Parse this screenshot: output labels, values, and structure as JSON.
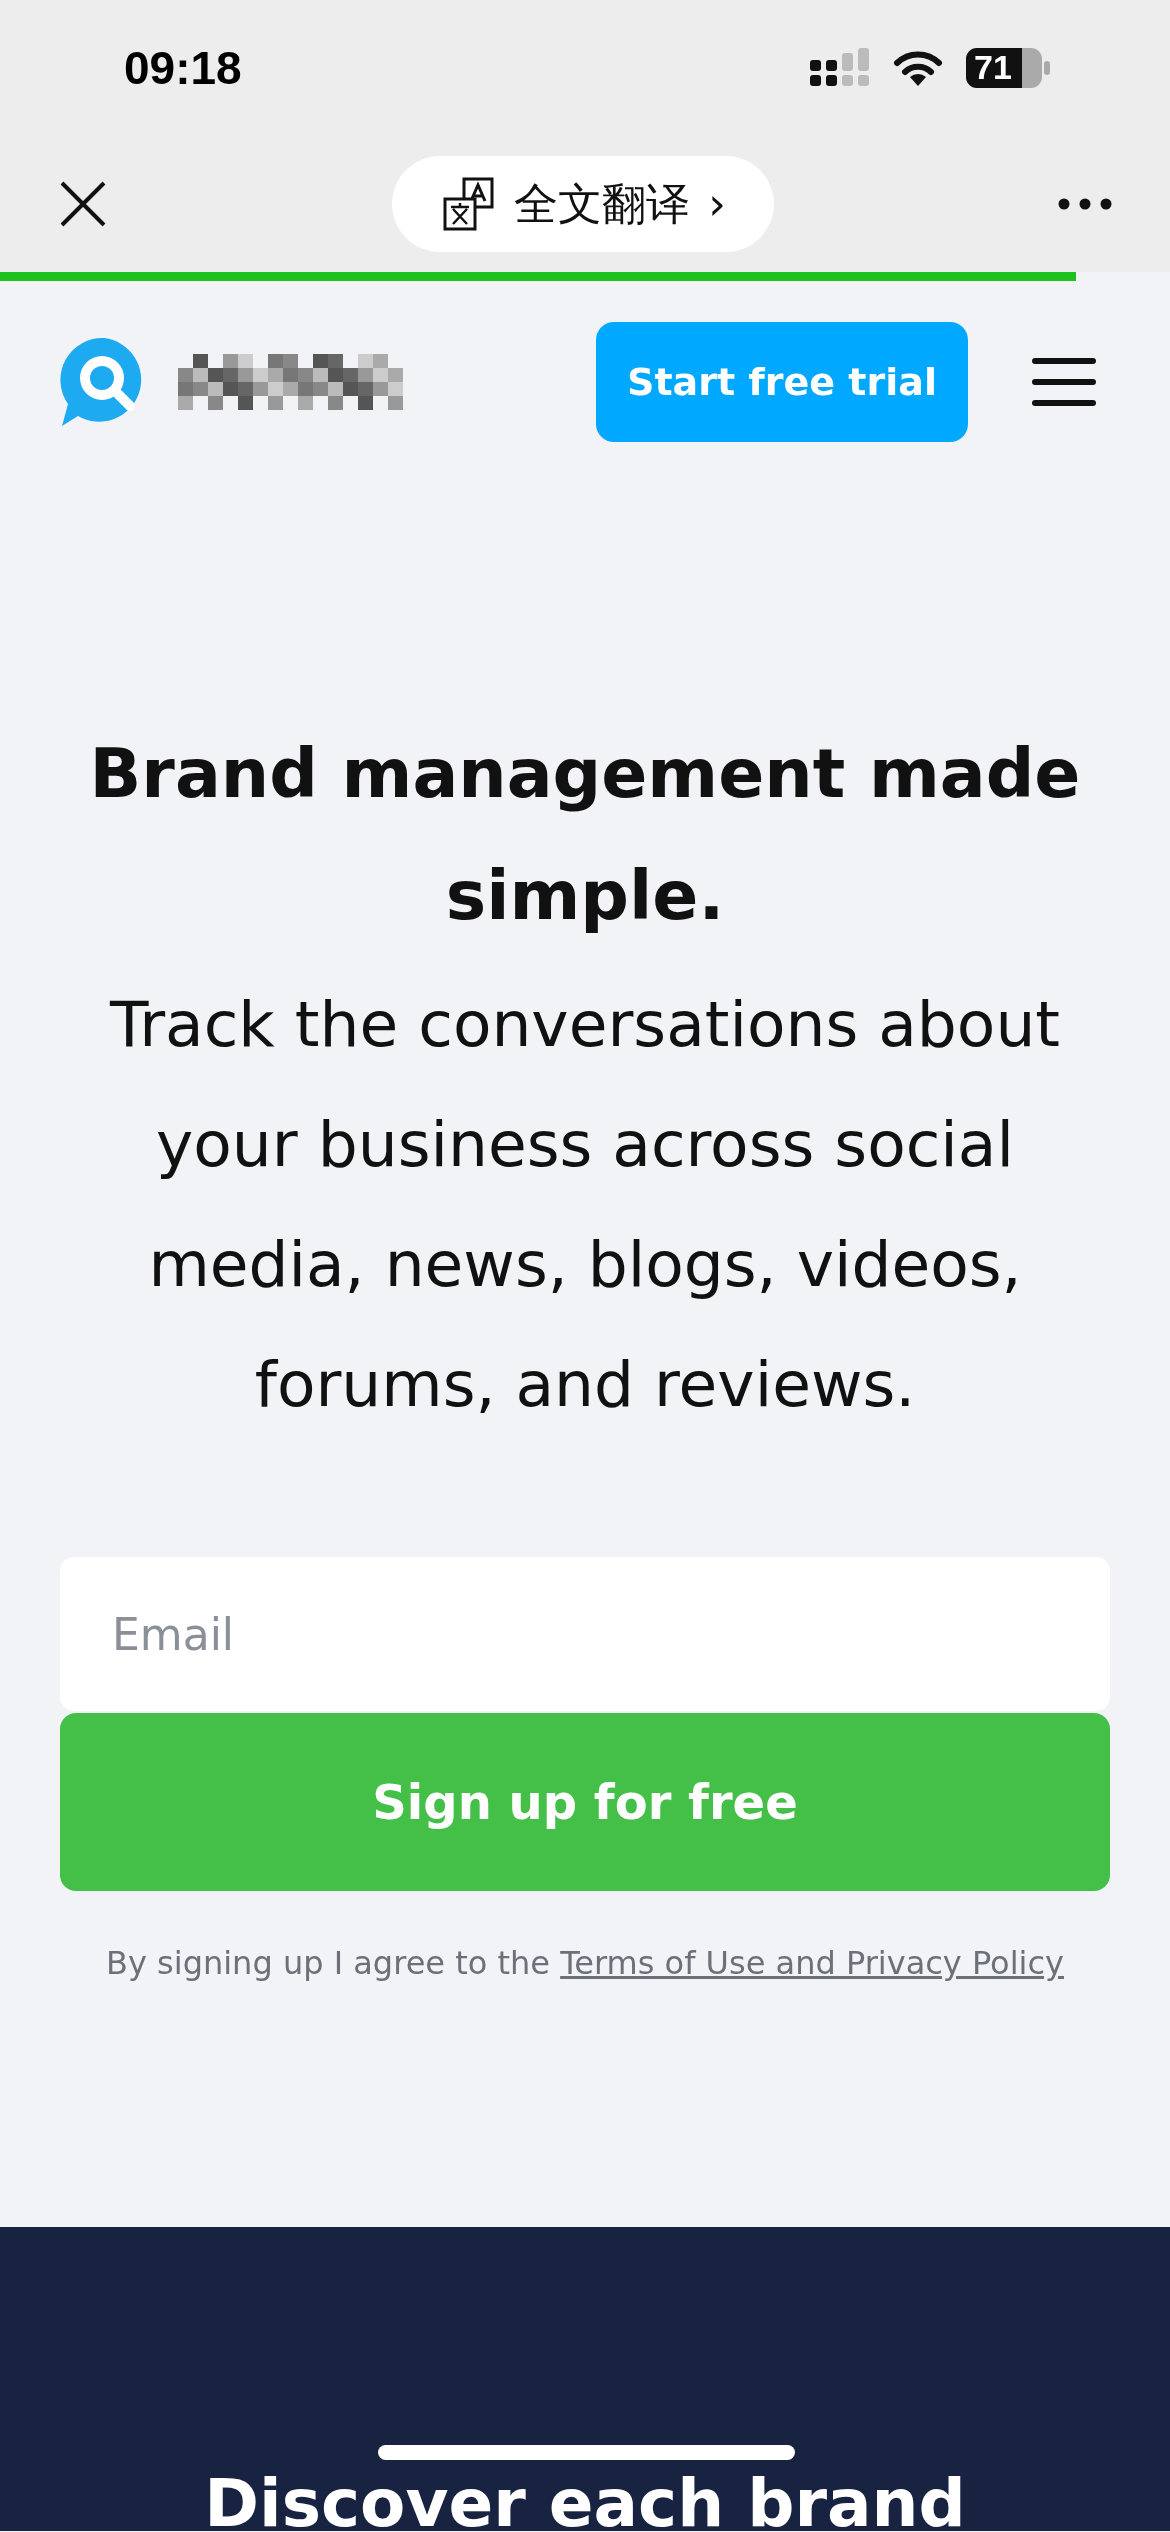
{
  "status_bar": {
    "time": "09:18",
    "battery": "71"
  },
  "browser_bar": {
    "translate_label": "全文翻译",
    "translate_caret": "›",
    "load_progress": {
      "level": 0.92
    }
  },
  "header": {
    "cta": "Start free trial"
  },
  "hero": {
    "title": "Brand management made simple.",
    "subtitle": "Track the conversations about your business across social media, news, blogs, videos, forums, and reviews.",
    "email": {
      "placeholder": "Email"
    },
    "signup": "Sign up for free",
    "terms_prefix": "By signing up I agree to the",
    "terms_link": "Terms of Use and Privacy Policy"
  },
  "next_section": {
    "title": "Discover each brand"
  }
}
